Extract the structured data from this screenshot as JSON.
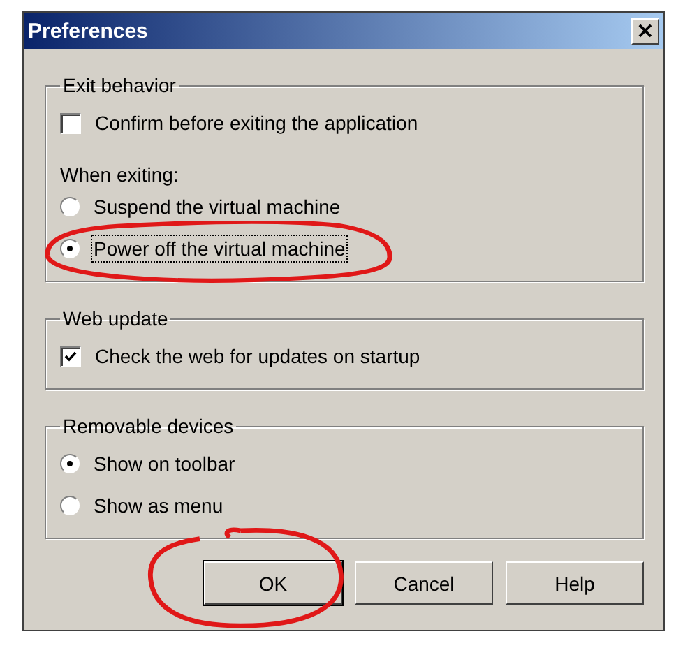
{
  "window": {
    "title": "Preferences",
    "close_label": "×"
  },
  "groups": [
    {
      "title": "Exit behavior",
      "items": [
        {
          "kind": "checkbox",
          "label": "Confirm before exiting the application",
          "checked": false,
          "focused": false
        },
        {
          "kind": "caption",
          "label": "When exiting:"
        },
        {
          "kind": "radio",
          "label": "Suspend the virtual machine",
          "selected": false,
          "focused": false
        },
        {
          "kind": "radio",
          "label": "Power off the virtual machine",
          "selected": true,
          "focused": true,
          "annotated": true
        }
      ]
    },
    {
      "title": "Web update",
      "items": [
        {
          "kind": "checkbox",
          "label": "Check the web for updates on startup",
          "checked": true,
          "focused": false
        }
      ]
    },
    {
      "title": "Removable devices",
      "items": [
        {
          "kind": "radio",
          "label": "Show on toolbar",
          "selected": true,
          "focused": false
        },
        {
          "kind": "radio",
          "label": "Show as menu",
          "selected": false,
          "focused": false
        }
      ]
    }
  ],
  "buttons": [
    {
      "label": "OK",
      "default": true,
      "annotated": true
    },
    {
      "label": "Cancel",
      "default": false
    },
    {
      "label": "Help",
      "default": false
    }
  ]
}
